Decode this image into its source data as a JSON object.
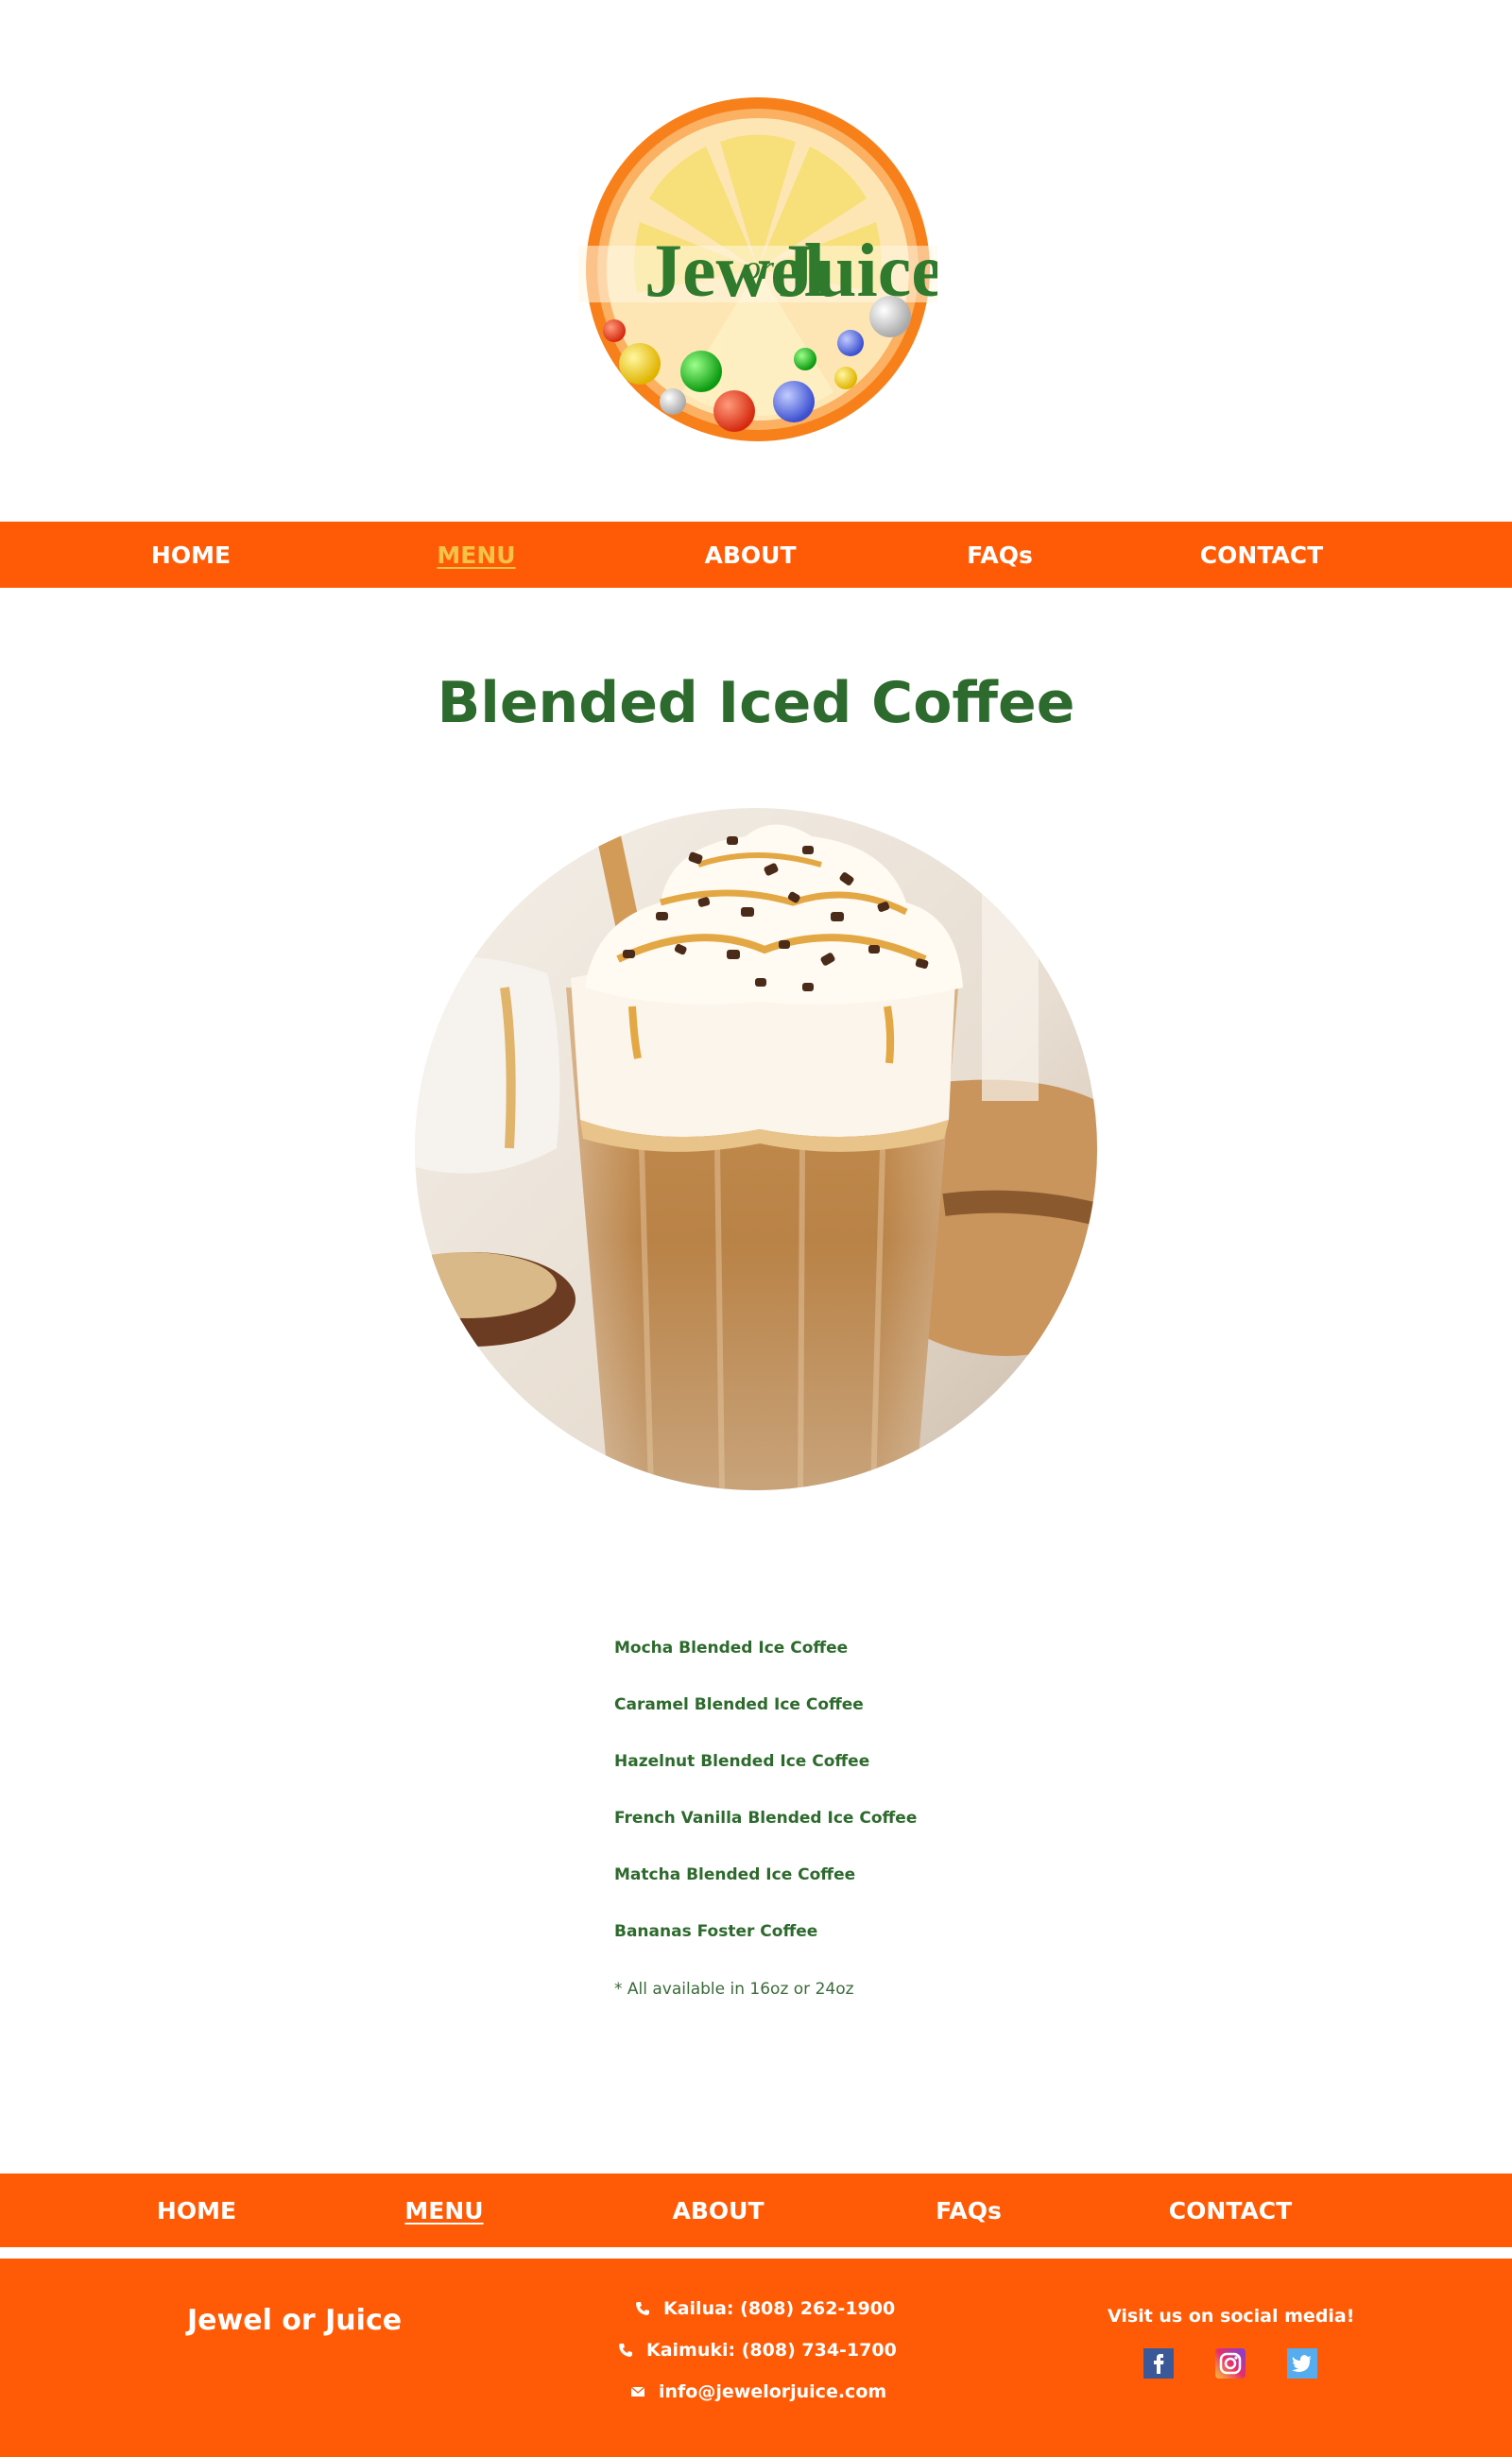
{
  "logo": {
    "word1": "Jewel",
    "word2": "or",
    "word3": "Juice",
    "colors": {
      "rind": "#f7801a",
      "pith": "#fde6b4",
      "segment": "#f7df73",
      "text": "#2f7a2c"
    }
  },
  "nav_top": {
    "items": [
      {
        "label": "HOME"
      },
      {
        "label": "MENU",
        "active": true
      },
      {
        "label": "ABOUT"
      },
      {
        "label": "FAQs"
      },
      {
        "label": "CONTACT"
      }
    ]
  },
  "page": {
    "title": "Blended Iced Coffee"
  },
  "menu": {
    "items": [
      "Mocha Blended Ice Coffee",
      "Caramel Blended Ice Coffee",
      "Hazelnut Blended Ice Coffee",
      "French Vanilla Blended Ice Coffee",
      "Matcha Blended Ice Coffee",
      "Bananas Foster Coffee"
    ],
    "note": "* All available in 16oz or 24oz"
  },
  "nav_bottom": {
    "items": [
      {
        "label": "HOME"
      },
      {
        "label": "MENU",
        "active": true
      },
      {
        "label": "ABOUT"
      },
      {
        "label": "FAQs"
      },
      {
        "label": "CONTACT"
      }
    ]
  },
  "footer": {
    "brand": "Jewel or Juice",
    "contacts": [
      {
        "icon": "phone-icon",
        "text": "Kailua: (808) 262-1900"
      },
      {
        "icon": "phone-icon",
        "text": "Kaimuki: (808) 734-1700"
      },
      {
        "icon": "mail-icon",
        "text": "info@jewelorjuice.com"
      }
    ],
    "social_heading": "Visit us on social media!",
    "social": [
      "facebook-icon",
      "instagram-icon",
      "twitter-icon"
    ]
  },
  "colors": {
    "accent": "#ff5b06",
    "title_green": "#2d6a2d",
    "active_nav": "#f7c248",
    "background": "#ffffff"
  }
}
